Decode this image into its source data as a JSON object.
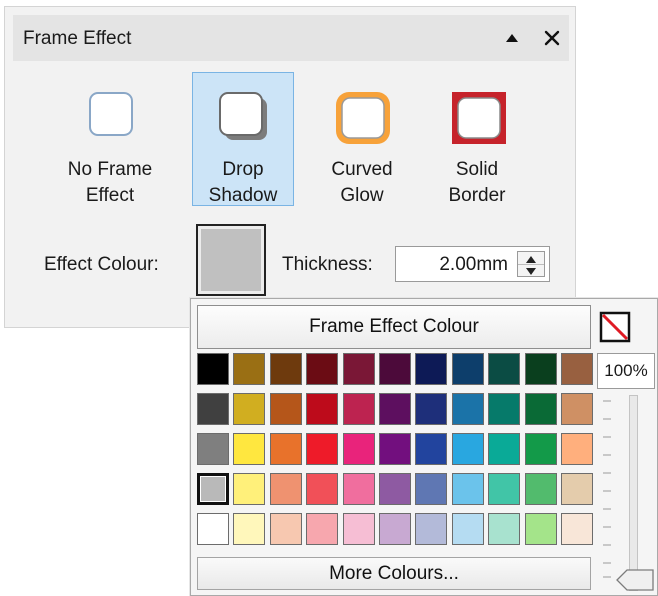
{
  "panel": {
    "title": "Frame Effect",
    "collapse_icon": "triangle-up-icon",
    "close_icon": "close-icon"
  },
  "effects": [
    {
      "label": "No Frame\nEffect",
      "icon": "no-frame-effect-icon",
      "selected": false
    },
    {
      "label": "Drop\nShadow",
      "icon": "drop-shadow-icon",
      "selected": true
    },
    {
      "label": "Curved\nGlow",
      "icon": "curved-glow-icon",
      "selected": false
    },
    {
      "label": "Solid\nBorder",
      "icon": "solid-border-icon",
      "selected": false
    }
  ],
  "effect_colour": {
    "label": "Effect Colour:",
    "value": "#c0c0c0"
  },
  "thickness": {
    "label": "Thickness:",
    "value": "2.00mm"
  },
  "popup": {
    "title": "Frame Effect Colour",
    "no_colour_icon": "no-colour-icon",
    "opacity": "100%",
    "opacity_level": 1.0,
    "more_colours": "More Colours...",
    "selected_colour": "#b9b9b9",
    "palette": [
      [
        "#000000",
        "#9a6f14",
        "#6e3a0d",
        "#6b0c14",
        "#7a1736",
        "#4c0a3a",
        "#0d1a56",
        "#0d3e6b",
        "#0b4c44",
        "#0a3f1e",
        "#986040"
      ],
      [
        "#404040",
        "#d1ae20",
        "#b5561a",
        "#bd0b1b",
        "#bd2350",
        "#5d0f5f",
        "#1e2f7a",
        "#1b73a8",
        "#067a6a",
        "#0a6a36",
        "#cf9064"
      ],
      [
        "#7f7f7f",
        "#ffe73f",
        "#e8722b",
        "#ee1b29",
        "#e9237b",
        "#720f7e",
        "#22449e",
        "#29a7e0",
        "#0aaa97",
        "#139a49",
        "#ffaf7d"
      ],
      [
        "#b9b9b9",
        "#fff07a",
        "#ef9270",
        "#f15058",
        "#f06e9e",
        "#8e5aa2",
        "#5f77b3",
        "#6bc3eb",
        "#41c5a7",
        "#52bb6d",
        "#e4ccac"
      ],
      [
        "#ffffff",
        "#fff7bb",
        "#f7c8b0",
        "#f7a7ae",
        "#f6bed4",
        "#c8a9d2",
        "#b3bad9",
        "#b5dcf2",
        "#a8e2cf",
        "#a4e48a",
        "#f8e6d8"
      ]
    ]
  }
}
